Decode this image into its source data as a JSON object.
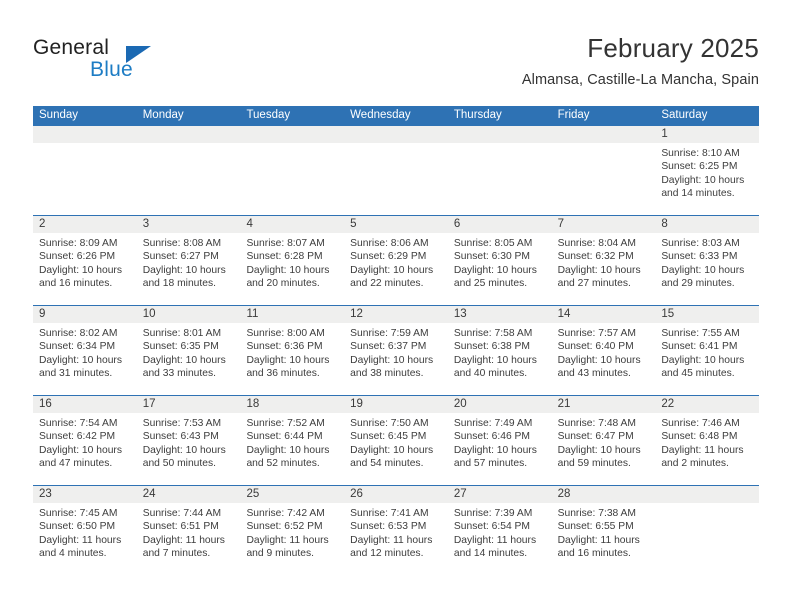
{
  "logo": {
    "word_one": "General",
    "word_two": "Blue",
    "flag_color": "#1b69b3",
    "text_color": "#1d7cc4"
  },
  "header": {
    "title": "February 2025",
    "subtitle": "Almansa, Castille-La Mancha, Spain"
  },
  "theme": {
    "header_blue": "#2e72b4",
    "daynum_band": "#efefee",
    "text": "#3d3d3d"
  },
  "weekdays": [
    "Sunday",
    "Monday",
    "Tuesday",
    "Wednesday",
    "Thursday",
    "Friday",
    "Saturday"
  ],
  "weeks": [
    {
      "days": [
        {
          "num": "",
          "detail": "",
          "empty": true
        },
        {
          "num": "",
          "detail": "",
          "empty": true
        },
        {
          "num": "",
          "detail": "",
          "empty": true
        },
        {
          "num": "",
          "detail": "",
          "empty": true
        },
        {
          "num": "",
          "detail": "",
          "empty": true
        },
        {
          "num": "",
          "detail": "",
          "empty": true
        },
        {
          "num": "1",
          "sunrise": "8:10 AM",
          "sunset": "6:25 PM",
          "daylight": "10 hours and 14 minutes.",
          "detail": "Sunrise: 8:10 AM\nSunset: 6:25 PM\nDaylight: 10 hours\nand 14 minutes."
        }
      ]
    },
    {
      "days": [
        {
          "num": "2",
          "sunrise": "8:09 AM",
          "sunset": "6:26 PM",
          "daylight": "10 hours and 16 minutes.",
          "detail": "Sunrise: 8:09 AM\nSunset: 6:26 PM\nDaylight: 10 hours\nand 16 minutes."
        },
        {
          "num": "3",
          "sunrise": "8:08 AM",
          "sunset": "6:27 PM",
          "daylight": "10 hours and 18 minutes.",
          "detail": "Sunrise: 8:08 AM\nSunset: 6:27 PM\nDaylight: 10 hours\nand 18 minutes."
        },
        {
          "num": "4",
          "sunrise": "8:07 AM",
          "sunset": "6:28 PM",
          "daylight": "10 hours and 20 minutes.",
          "detail": "Sunrise: 8:07 AM\nSunset: 6:28 PM\nDaylight: 10 hours\nand 20 minutes."
        },
        {
          "num": "5",
          "sunrise": "8:06 AM",
          "sunset": "6:29 PM",
          "daylight": "10 hours and 22 minutes.",
          "detail": "Sunrise: 8:06 AM\nSunset: 6:29 PM\nDaylight: 10 hours\nand 22 minutes."
        },
        {
          "num": "6",
          "sunrise": "8:05 AM",
          "sunset": "6:30 PM",
          "daylight": "10 hours and 25 minutes.",
          "detail": "Sunrise: 8:05 AM\nSunset: 6:30 PM\nDaylight: 10 hours\nand 25 minutes."
        },
        {
          "num": "7",
          "sunrise": "8:04 AM",
          "sunset": "6:32 PM",
          "daylight": "10 hours and 27 minutes.",
          "detail": "Sunrise: 8:04 AM\nSunset: 6:32 PM\nDaylight: 10 hours\nand 27 minutes."
        },
        {
          "num": "8",
          "sunrise": "8:03 AM",
          "sunset": "6:33 PM",
          "daylight": "10 hours and 29 minutes.",
          "detail": "Sunrise: 8:03 AM\nSunset: 6:33 PM\nDaylight: 10 hours\nand 29 minutes."
        }
      ]
    },
    {
      "days": [
        {
          "num": "9",
          "sunrise": "8:02 AM",
          "sunset": "6:34 PM",
          "daylight": "10 hours and 31 minutes.",
          "detail": "Sunrise: 8:02 AM\nSunset: 6:34 PM\nDaylight: 10 hours\nand 31 minutes."
        },
        {
          "num": "10",
          "sunrise": "8:01 AM",
          "sunset": "6:35 PM",
          "daylight": "10 hours and 33 minutes.",
          "detail": "Sunrise: 8:01 AM\nSunset: 6:35 PM\nDaylight: 10 hours\nand 33 minutes."
        },
        {
          "num": "11",
          "sunrise": "8:00 AM",
          "sunset": "6:36 PM",
          "daylight": "10 hours and 36 minutes.",
          "detail": "Sunrise: 8:00 AM\nSunset: 6:36 PM\nDaylight: 10 hours\nand 36 minutes."
        },
        {
          "num": "12",
          "sunrise": "7:59 AM",
          "sunset": "6:37 PM",
          "daylight": "10 hours and 38 minutes.",
          "detail": "Sunrise: 7:59 AM\nSunset: 6:37 PM\nDaylight: 10 hours\nand 38 minutes."
        },
        {
          "num": "13",
          "sunrise": "7:58 AM",
          "sunset": "6:38 PM",
          "daylight": "10 hours and 40 minutes.",
          "detail": "Sunrise: 7:58 AM\nSunset: 6:38 PM\nDaylight: 10 hours\nand 40 minutes."
        },
        {
          "num": "14",
          "sunrise": "7:57 AM",
          "sunset": "6:40 PM",
          "daylight": "10 hours and 43 minutes.",
          "detail": "Sunrise: 7:57 AM\nSunset: 6:40 PM\nDaylight: 10 hours\nand 43 minutes."
        },
        {
          "num": "15",
          "sunrise": "7:55 AM",
          "sunset": "6:41 PM",
          "daylight": "10 hours and 45 minutes.",
          "detail": "Sunrise: 7:55 AM\nSunset: 6:41 PM\nDaylight: 10 hours\nand 45 minutes."
        }
      ]
    },
    {
      "days": [
        {
          "num": "16",
          "sunrise": "7:54 AM",
          "sunset": "6:42 PM",
          "daylight": "10 hours and 47 minutes.",
          "detail": "Sunrise: 7:54 AM\nSunset: 6:42 PM\nDaylight: 10 hours\nand 47 minutes."
        },
        {
          "num": "17",
          "sunrise": "7:53 AM",
          "sunset": "6:43 PM",
          "daylight": "10 hours and 50 minutes.",
          "detail": "Sunrise: 7:53 AM\nSunset: 6:43 PM\nDaylight: 10 hours\nand 50 minutes."
        },
        {
          "num": "18",
          "sunrise": "7:52 AM",
          "sunset": "6:44 PM",
          "daylight": "10 hours and 52 minutes.",
          "detail": "Sunrise: 7:52 AM\nSunset: 6:44 PM\nDaylight: 10 hours\nand 52 minutes."
        },
        {
          "num": "19",
          "sunrise": "7:50 AM",
          "sunset": "6:45 PM",
          "daylight": "10 hours and 54 minutes.",
          "detail": "Sunrise: 7:50 AM\nSunset: 6:45 PM\nDaylight: 10 hours\nand 54 minutes."
        },
        {
          "num": "20",
          "sunrise": "7:49 AM",
          "sunset": "6:46 PM",
          "daylight": "10 hours and 57 minutes.",
          "detail": "Sunrise: 7:49 AM\nSunset: 6:46 PM\nDaylight: 10 hours\nand 57 minutes."
        },
        {
          "num": "21",
          "sunrise": "7:48 AM",
          "sunset": "6:47 PM",
          "daylight": "10 hours and 59 minutes.",
          "detail": "Sunrise: 7:48 AM\nSunset: 6:47 PM\nDaylight: 10 hours\nand 59 minutes."
        },
        {
          "num": "22",
          "sunrise": "7:46 AM",
          "sunset": "6:48 PM",
          "daylight": "11 hours and 2 minutes.",
          "detail": "Sunrise: 7:46 AM\nSunset: 6:48 PM\nDaylight: 11 hours\nand 2 minutes."
        }
      ]
    },
    {
      "days": [
        {
          "num": "23",
          "sunrise": "7:45 AM",
          "sunset": "6:50 PM",
          "daylight": "11 hours and 4 minutes.",
          "detail": "Sunrise: 7:45 AM\nSunset: 6:50 PM\nDaylight: 11 hours\nand 4 minutes."
        },
        {
          "num": "24",
          "sunrise": "7:44 AM",
          "sunset": "6:51 PM",
          "daylight": "11 hours and 7 minutes.",
          "detail": "Sunrise: 7:44 AM\nSunset: 6:51 PM\nDaylight: 11 hours\nand 7 minutes."
        },
        {
          "num": "25",
          "sunrise": "7:42 AM",
          "sunset": "6:52 PM",
          "daylight": "11 hours and 9 minutes.",
          "detail": "Sunrise: 7:42 AM\nSunset: 6:52 PM\nDaylight: 11 hours\nand 9 minutes."
        },
        {
          "num": "26",
          "sunrise": "7:41 AM",
          "sunset": "6:53 PM",
          "daylight": "11 hours and 12 minutes.",
          "detail": "Sunrise: 7:41 AM\nSunset: 6:53 PM\nDaylight: 11 hours\nand 12 minutes."
        },
        {
          "num": "27",
          "sunrise": "7:39 AM",
          "sunset": "6:54 PM",
          "daylight": "11 hours and 14 minutes.",
          "detail": "Sunrise: 7:39 AM\nSunset: 6:54 PM\nDaylight: 11 hours\nand 14 minutes."
        },
        {
          "num": "28",
          "sunrise": "7:38 AM",
          "sunset": "6:55 PM",
          "daylight": "11 hours and 16 minutes.",
          "detail": "Sunrise: 7:38 AM\nSunset: 6:55 PM\nDaylight: 11 hours\nand 16 minutes."
        },
        {
          "num": "",
          "detail": "",
          "empty": true
        }
      ]
    }
  ]
}
